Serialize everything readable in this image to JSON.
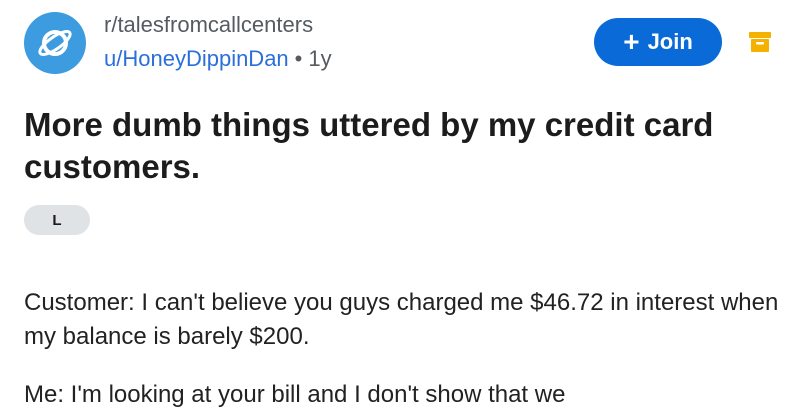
{
  "post": {
    "subreddit": "r/talesfromcallcenters",
    "author": "u/HoneyDippinDan",
    "separator": "•",
    "age": "1y",
    "join_label": "Join",
    "title": "More dumb things uttered by my credit card customers.",
    "flair": "L",
    "paragraphs": [
      "Customer: I can't believe you guys charged me $46.72 in interest when my balance is barely $200.",
      "Me: I'm looking at your bill and I don't show that we"
    ]
  },
  "icons": {
    "avatar": "planet-icon",
    "join": "plus-icon",
    "archive": "archive-icon"
  },
  "colors": {
    "avatar_bg": "#3d9be0",
    "join_bg": "#0a6ad8",
    "username": "#2a6fdc",
    "archive": "#f5b100",
    "flair_bg": "#dfe3e6"
  }
}
